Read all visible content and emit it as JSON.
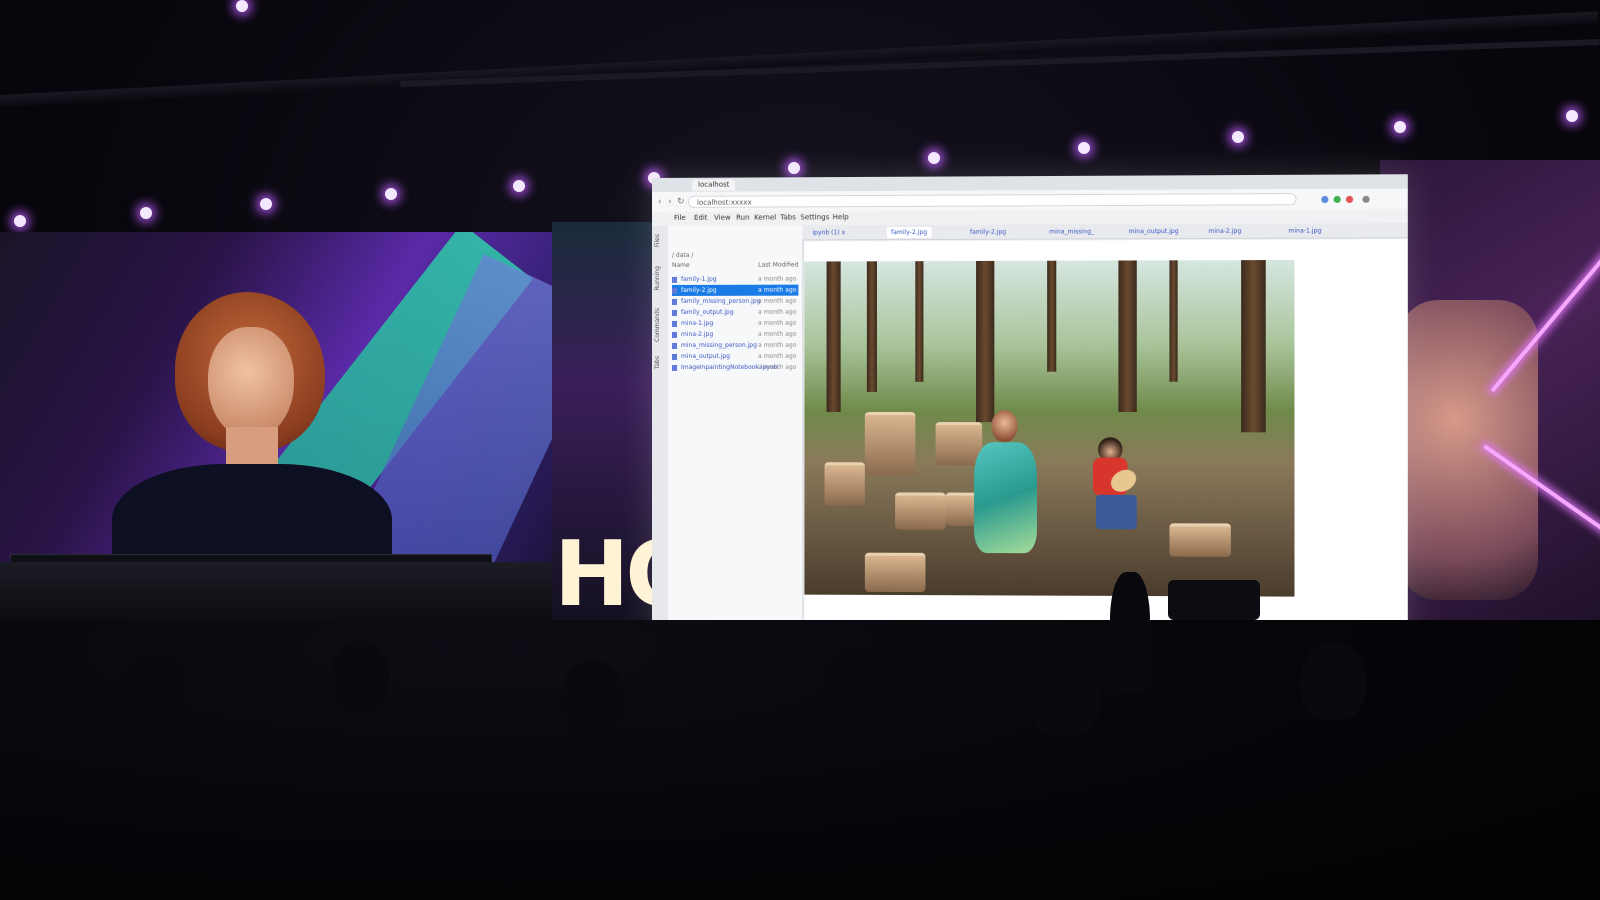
{
  "scene": {
    "left_screen": {
      "big_text": "HO"
    },
    "editor": {
      "browser_tab": "localhost",
      "url": "localhost:xxxxx",
      "menu": [
        "File",
        "Edit",
        "View",
        "Run",
        "Kernel",
        "Tabs",
        "Settings",
        "Help"
      ],
      "rail_labels": [
        "Files",
        "Running",
        "Commands",
        "Tabs"
      ],
      "file_panel": {
        "path": "/ data /",
        "col_name": "Name",
        "col_modified": "Last Modified",
        "files": [
          {
            "name": "family-1.jpg",
            "modified": "a month ago",
            "selected": false
          },
          {
            "name": "family-2.jpg",
            "modified": "a month ago",
            "selected": true
          },
          {
            "name": "family_missing_person.jpg",
            "modified": "a month ago",
            "selected": false
          },
          {
            "name": "family_output.jpg",
            "modified": "a month ago",
            "selected": false
          },
          {
            "name": "mina-1.jpg",
            "modified": "a month ago",
            "selected": false
          },
          {
            "name": "mina-2.jpg",
            "modified": "a month ago",
            "selected": false
          },
          {
            "name": "mina_missing_person.jpg",
            "modified": "a month ago",
            "selected": false
          },
          {
            "name": "mina_output.jpg",
            "modified": "a month ago",
            "selected": false
          },
          {
            "name": "ImageInpaintingNotebook.ipynb",
            "modified": "a month ago",
            "selected": false
          }
        ]
      },
      "editor_tabs": [
        "ipynb (1) x",
        "family-2.jpg",
        "family-2.jpg",
        "mina_missing_",
        "mina_output.jpg",
        "mina-2.jpg",
        "mina-1.jpg"
      ],
      "active_tab": 1
    }
  }
}
